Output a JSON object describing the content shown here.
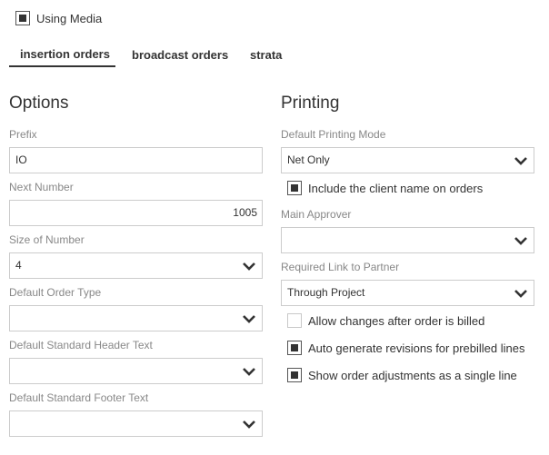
{
  "media": {
    "label": "Using Media",
    "checked": true
  },
  "tabs": [
    {
      "label": "insertion orders",
      "active": true
    },
    {
      "label": "broadcast orders",
      "active": false
    },
    {
      "label": "strata",
      "active": false
    }
  ],
  "options": {
    "title": "Options",
    "prefix": {
      "label": "Prefix",
      "value": "IO"
    },
    "next_number": {
      "label": "Next Number",
      "value": "1005"
    },
    "size_of_number": {
      "label": "Size of Number",
      "value": "4"
    },
    "default_order_type": {
      "label": "Default Order Type",
      "value": ""
    },
    "header_text": {
      "label": "Default Standard Header Text",
      "value": ""
    },
    "footer_text": {
      "label": "Default Standard Footer Text",
      "value": ""
    }
  },
  "printing": {
    "title": "Printing",
    "mode": {
      "label": "Default Printing Mode",
      "value": "Net Only"
    },
    "include_client": {
      "label": "Include the client name on orders",
      "checked": true
    },
    "approver": {
      "label": "Main Approver",
      "value": ""
    },
    "link_partner": {
      "label": "Required Link to Partner",
      "value": "Through Project"
    },
    "allow_changes": {
      "label": "Allow changes after order is billed",
      "checked": false
    },
    "auto_generate": {
      "label": "Auto generate revisions for prebilled lines",
      "checked": true
    },
    "show_adjustments": {
      "label": "Show order adjustments as a single line",
      "checked": true
    }
  },
  "icons": {
    "checkbox": "checkbox-icon",
    "dropdown": "chevron-down-icon"
  },
  "colors": {
    "text": "#333333",
    "label": "#888888",
    "border": "#cccccc"
  }
}
